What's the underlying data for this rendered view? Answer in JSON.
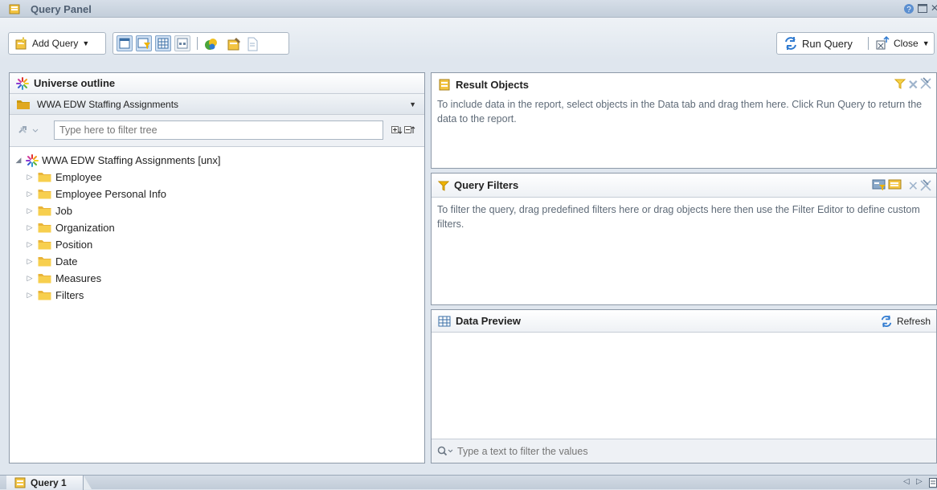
{
  "window": {
    "title": "Query Panel"
  },
  "toolbar": {
    "add_query": "Add Query",
    "run_query": "Run Query",
    "close": "Close"
  },
  "universe": {
    "title": "Universe outline",
    "selected": "WWA EDW Staffing Assignments",
    "filter_placeholder": "Type here to filter tree",
    "root": "WWA EDW Staffing Assignments [unx]",
    "folders": [
      "Employee",
      "Employee Personal Info",
      "Job",
      "Organization",
      "Position",
      "Date",
      "Measures",
      "Filters"
    ]
  },
  "result_objects": {
    "title": "Result Objects",
    "hint": "To include data in the report, select objects in the Data tab and drag them here. Click Run Query to return the data to the report."
  },
  "query_filters": {
    "title": "Query Filters",
    "hint": "To filter the query, drag predefined filters here or drag objects here then use the Filter Editor to define custom filters."
  },
  "data_preview": {
    "title": "Data Preview",
    "refresh": "Refresh",
    "filter_placeholder": "Type a text to filter the values"
  },
  "tabs": {
    "query1": "Query 1"
  },
  "colors": {
    "folder": "#f3c23c",
    "accent": "#3a6ea5",
    "filter": "#f0b400"
  }
}
